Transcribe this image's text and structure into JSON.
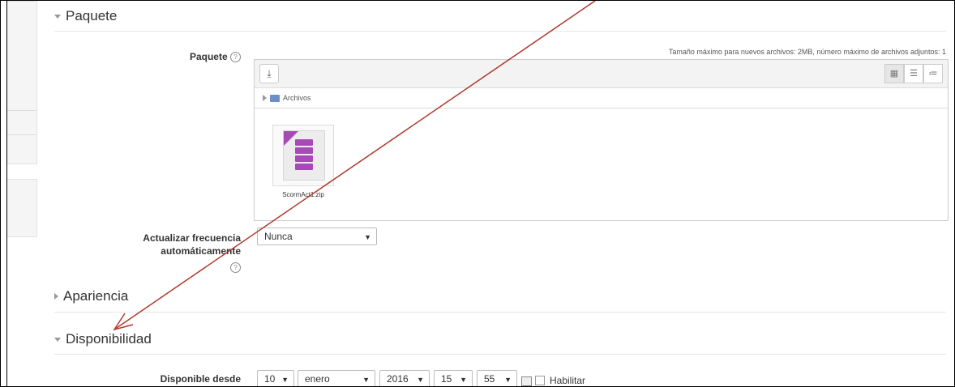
{
  "sections": {
    "paquete": {
      "title": "Paquete"
    },
    "apariencia": {
      "title": "Apariencia"
    },
    "disponibilidad": {
      "title": "Disponibilidad"
    }
  },
  "package_field": {
    "label": "Paquete",
    "max_size_note": "Tamaño máximo para nuevos archivos: 2MB, número máximo de archivos adjuntos: 1",
    "path_label": "Archivos",
    "file_name": "ScormAct1.zip",
    "add_icon": "download-icon",
    "view_icons": [
      "grid-view-icon",
      "list-view-icon",
      "tree-view-icon"
    ]
  },
  "update_frequency": {
    "label_line1": "Actualizar frecuencia",
    "label_line2": "automáticamente",
    "value": "Nunca"
  },
  "available_from": {
    "label": "Disponible desde",
    "day": "10",
    "month": "enero",
    "year": "2016",
    "hour": "15",
    "minute": "55",
    "enable_label": "Habilitar"
  },
  "help_glyph": "?",
  "colors": {
    "arrow": "#b03a2e",
    "zip_accent": "#a64bb5"
  }
}
